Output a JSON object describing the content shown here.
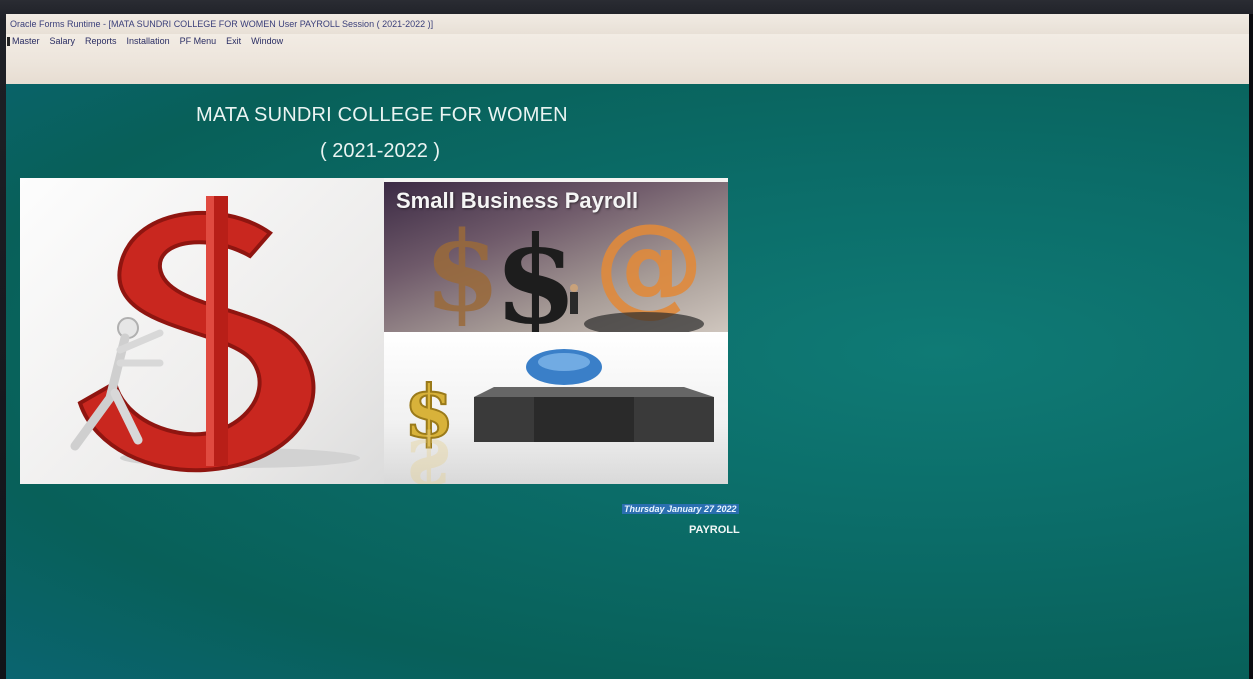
{
  "window": {
    "title": "Oracle Forms Runtime - [MATA SUNDRI COLLEGE FOR WOMEN User PAYROLL Session ( 2021-2022 )]"
  },
  "menu": {
    "items": [
      "Master",
      "Salary",
      "Reports",
      "Installation",
      "PF Menu",
      "Exit",
      "Window"
    ]
  },
  "main": {
    "college_name": "MATA SUNDRI COLLEGE FOR WOMEN",
    "session_year": "( 2021-2022 )",
    "banner_caption": "Small Business Payroll",
    "date": "Thursday January 27 2022",
    "module": "PAYROLL"
  },
  "colors": {
    "background": "#0b6f69",
    "menubar": "#ede5dc",
    "dollar_red": "#c9271f",
    "date_highlight": "#2b6fb0"
  },
  "icons": {
    "banner_left": "red-dollar-sign-with-figure-icon",
    "banner_top_right": "dollar-and-at-symbols-icon",
    "banner_bottom_right": "gold-dollar-and-globe-icon"
  }
}
